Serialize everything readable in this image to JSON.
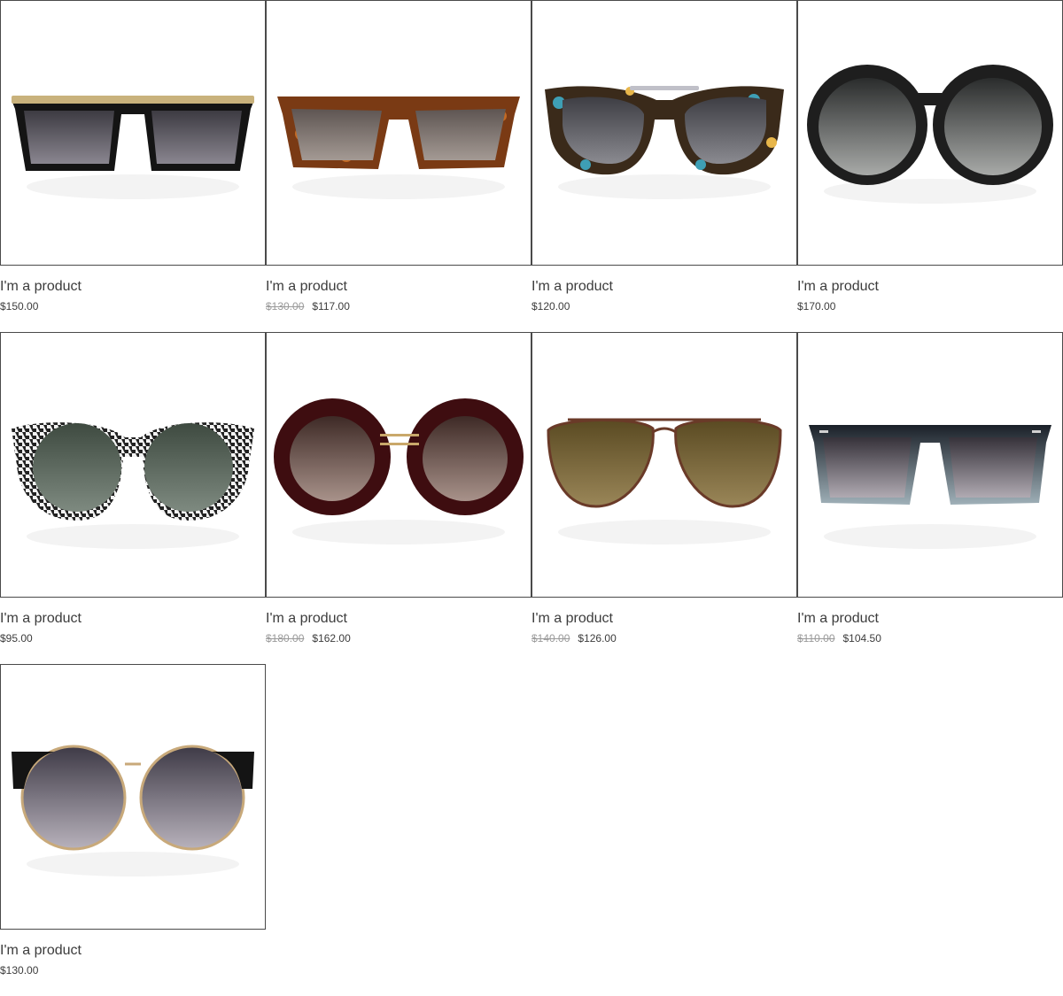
{
  "products": [
    {
      "name": "I'm a product",
      "old_price": "",
      "price": "$150.00",
      "icon": "square-black-sunglasses-image",
      "frame_color": "#151515",
      "accent_color": "#c9b27c",
      "lens_color": "#55525a"
    },
    {
      "name": "I'm a product",
      "old_price": "$130.00",
      "price": "$117.00",
      "icon": "tortoise-wayfarer-sunglasses-image",
      "frame_color": "#7a3a14",
      "accent_color": "#c46a23",
      "lens_color": "#7a6f6a"
    },
    {
      "name": "I'm a product",
      "old_price": "",
      "price": "$120.00",
      "icon": "multicolor-tortoise-sunglasses-image",
      "frame_color": "#3a2a1a",
      "accent_color": "#3e9fb5",
      "lens_color": "#56565a"
    },
    {
      "name": "I'm a product",
      "old_price": "",
      "price": "$170.00",
      "icon": "round-black-sunglasses-image",
      "frame_color": "#1e1e1e",
      "accent_color": "#2a2a2a",
      "lens_color": "#4a4c4c"
    },
    {
      "name": "I'm a product",
      "old_price": "",
      "price": "$95.00",
      "icon": "houndstooth-round-sunglasses-image",
      "frame_color": "#222222",
      "accent_color": "#f2f2f2",
      "lens_color": "#4f5a50"
    },
    {
      "name": "I'm a product",
      "old_price": "$180.00",
      "price": "$162.00",
      "icon": "burgundy-round-sunglasses-image",
      "frame_color": "#3e0d10",
      "accent_color": "#c9a86a",
      "lens_color": "#5a4038"
    },
    {
      "name": "I'm a product",
      "old_price": "$140.00",
      "price": "$126.00",
      "icon": "brown-aviator-sunglasses-image",
      "frame_color": "#6a3a28",
      "accent_color": "#8a5a40",
      "lens_color": "#6b5a2e"
    },
    {
      "name": "I'm a product",
      "old_price": "$110.00",
      "price": "$104.50",
      "icon": "gradient-square-sunglasses-image",
      "frame_color": "#1a2028",
      "accent_color": "#9fb0b8",
      "lens_color": "#4e4a52"
    },
    {
      "name": "I'm a product",
      "old_price": "",
      "price": "$130.00",
      "icon": "browline-gold-sunglasses-image",
      "frame_color": "#141414",
      "accent_color": "#c8a97a",
      "lens_color": "#4a4650"
    }
  ]
}
